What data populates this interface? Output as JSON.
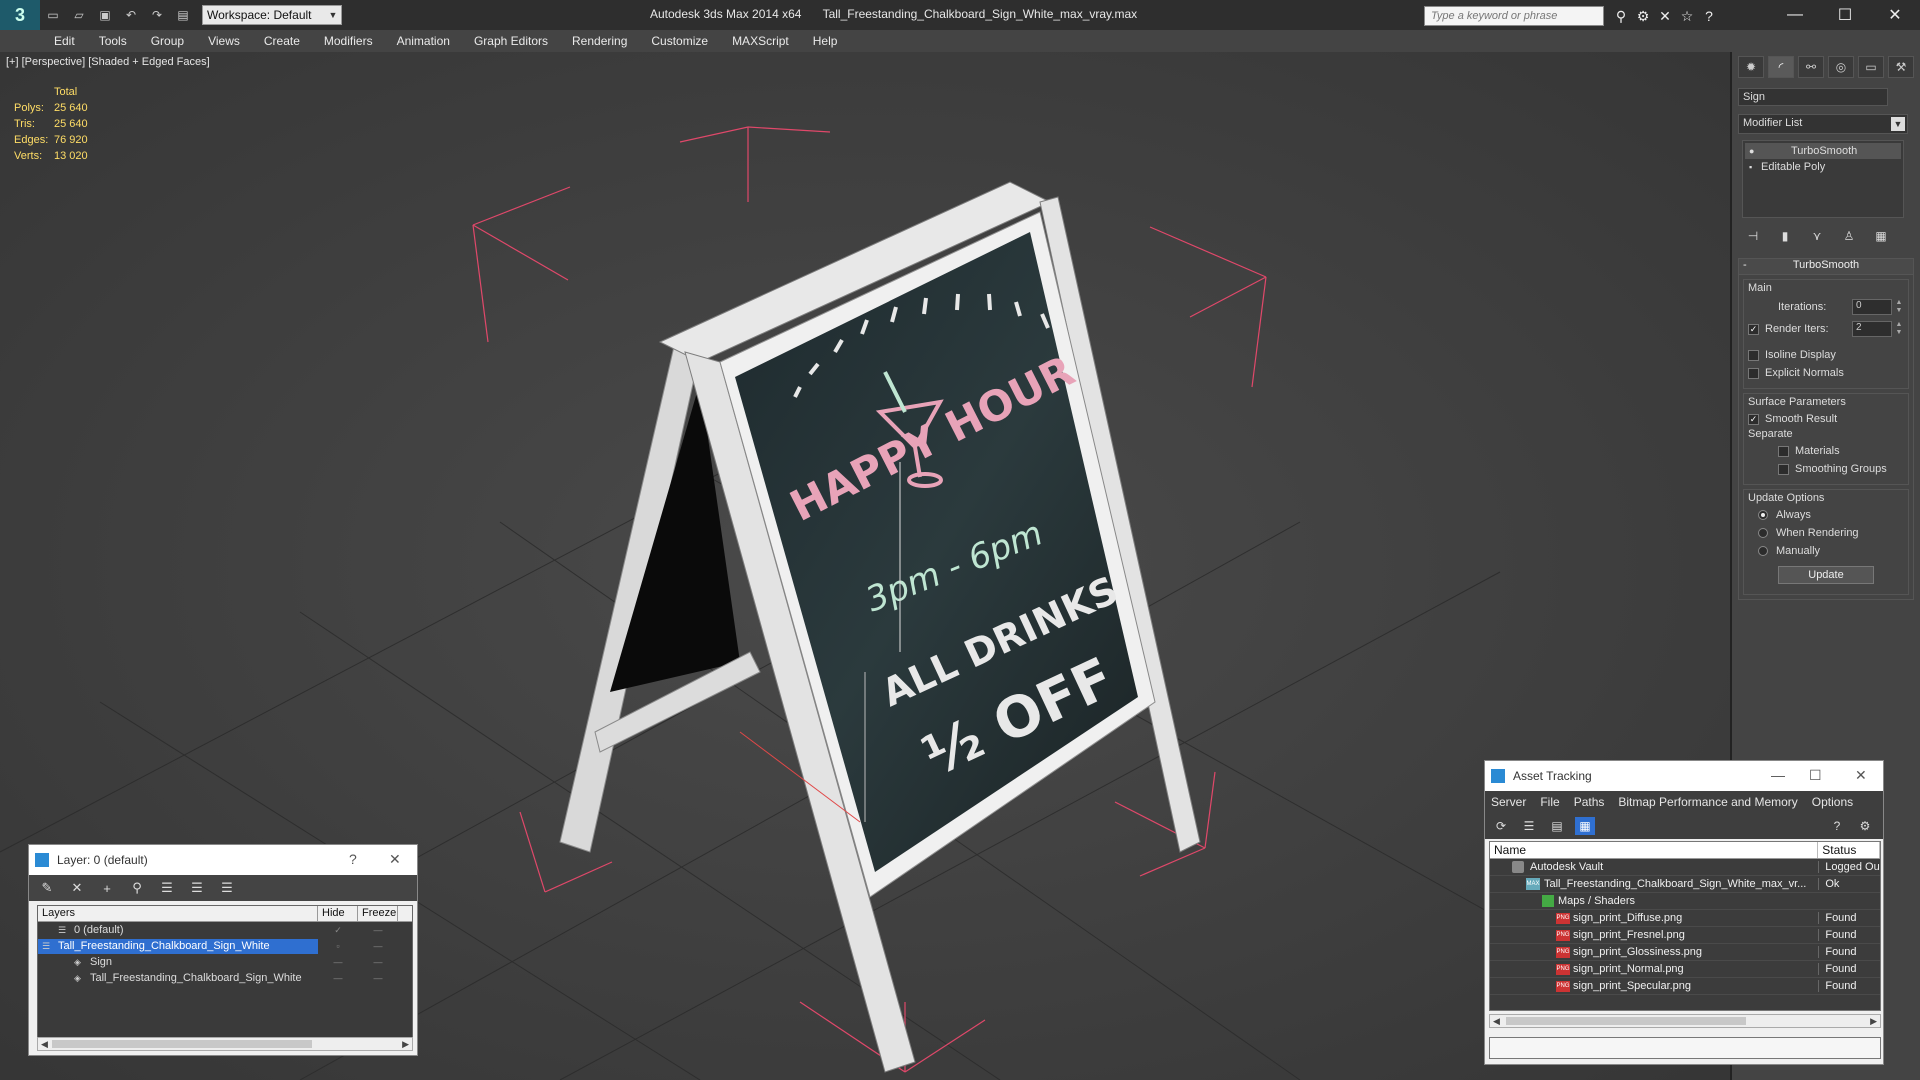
{
  "title_bar": {
    "workspace": "Workspace: Default",
    "app_name": "Autodesk 3ds Max  2014 x64",
    "file_name": "Tall_Freestanding_Chalkboard_Sign_White_max_vray.max",
    "search_placeholder": "Type a keyword or phrase"
  },
  "menu": [
    "Edit",
    "Tools",
    "Group",
    "Views",
    "Create",
    "Modifiers",
    "Animation",
    "Graph Editors",
    "Rendering",
    "Customize",
    "MAXScript",
    "Help"
  ],
  "viewport": {
    "label": "[+] [Perspective] [Shaded + Edged Faces]",
    "stats_header": "Total",
    "stats": [
      {
        "k": "Polys:",
        "v": "25 640"
      },
      {
        "k": "Tris:",
        "v": "25 640"
      },
      {
        "k": "Edges:",
        "v": "76 920"
      },
      {
        "k": "Verts:",
        "v": "13 020"
      }
    ],
    "board_text": {
      "line1": "HAPPY HOUR",
      "line2": "3pm - 6pm",
      "line3": "ALL DRINKS",
      "line4": "½ OFF"
    }
  },
  "command_panel": {
    "object_name": "Sign",
    "modifier_list": "Modifier List",
    "stack": [
      {
        "label": "TurboSmooth",
        "selected": true
      },
      {
        "label": "Editable Poly",
        "selected": false
      }
    ],
    "rollout_title": "TurboSmooth",
    "main_group": "Main",
    "iterations_label": "Iterations:",
    "iterations_value": "0",
    "render_iters_label": "Render Iters:",
    "render_iters_value": "2",
    "isoline_label": "Isoline Display",
    "explicit_normals_label": "Explicit Normals",
    "surface_group": "Surface Parameters",
    "smooth_result_label": "Smooth Result",
    "separate_label": "Separate",
    "materials_label": "Materials",
    "smoothing_groups_label": "Smoothing Groups",
    "update_group": "Update Options",
    "always_label": "Always",
    "when_rendering_label": "When Rendering",
    "manually_label": "Manually",
    "update_button": "Update"
  },
  "layer_dialog": {
    "title": "Layer: 0 (default)",
    "help": "?",
    "col_layers": "Layers",
    "col_hide": "Hide",
    "col_freeze": "Freeze",
    "rows": [
      {
        "name": "0 (default)",
        "indent": 1
      },
      {
        "name": "Tall_Freestanding_Chalkboard_Sign_White",
        "indent": 0,
        "selected": true
      },
      {
        "name": "Sign",
        "indent": 2
      },
      {
        "name": "Tall_Freestanding_Chalkboard_Sign_White",
        "indent": 2
      }
    ]
  },
  "asset_dialog": {
    "title": "Asset Tracking",
    "menu": [
      "Server",
      "File",
      "Paths",
      "Bitmap Performance and Memory",
      "Options"
    ],
    "col_name": "Name",
    "col_status": "Status",
    "rows": [
      {
        "name": "Autodesk Vault",
        "status": "Logged Ou",
        "type": "vault",
        "indent": 1
      },
      {
        "name": "Tall_Freestanding_Chalkboard_Sign_White_max_vr...",
        "status": "Ok",
        "type": "max",
        "indent": 2
      },
      {
        "name": "Maps / Shaders",
        "status": "",
        "type": "map",
        "indent": 3
      },
      {
        "name": "sign_print_Diffuse.png",
        "status": "Found",
        "type": "png",
        "indent": 4
      },
      {
        "name": "sign_print_Fresnel.png",
        "status": "Found",
        "type": "png",
        "indent": 4
      },
      {
        "name": "sign_print_Glossiness.png",
        "status": "Found",
        "type": "png",
        "indent": 4
      },
      {
        "name": "sign_print_Normal.png",
        "status": "Found",
        "type": "png",
        "indent": 4
      },
      {
        "name": "sign_print_Specular.png",
        "status": "Found",
        "type": "png",
        "indent": 4
      }
    ]
  },
  "colors": {
    "stats_text": "#ffdd66",
    "selection": "#2f6fd0",
    "bounding_box": "#e0486a",
    "chalk_pink": "#e8a3b8",
    "chalk_white": "#e8e8e8",
    "chalk_green": "#bfe6d2"
  }
}
